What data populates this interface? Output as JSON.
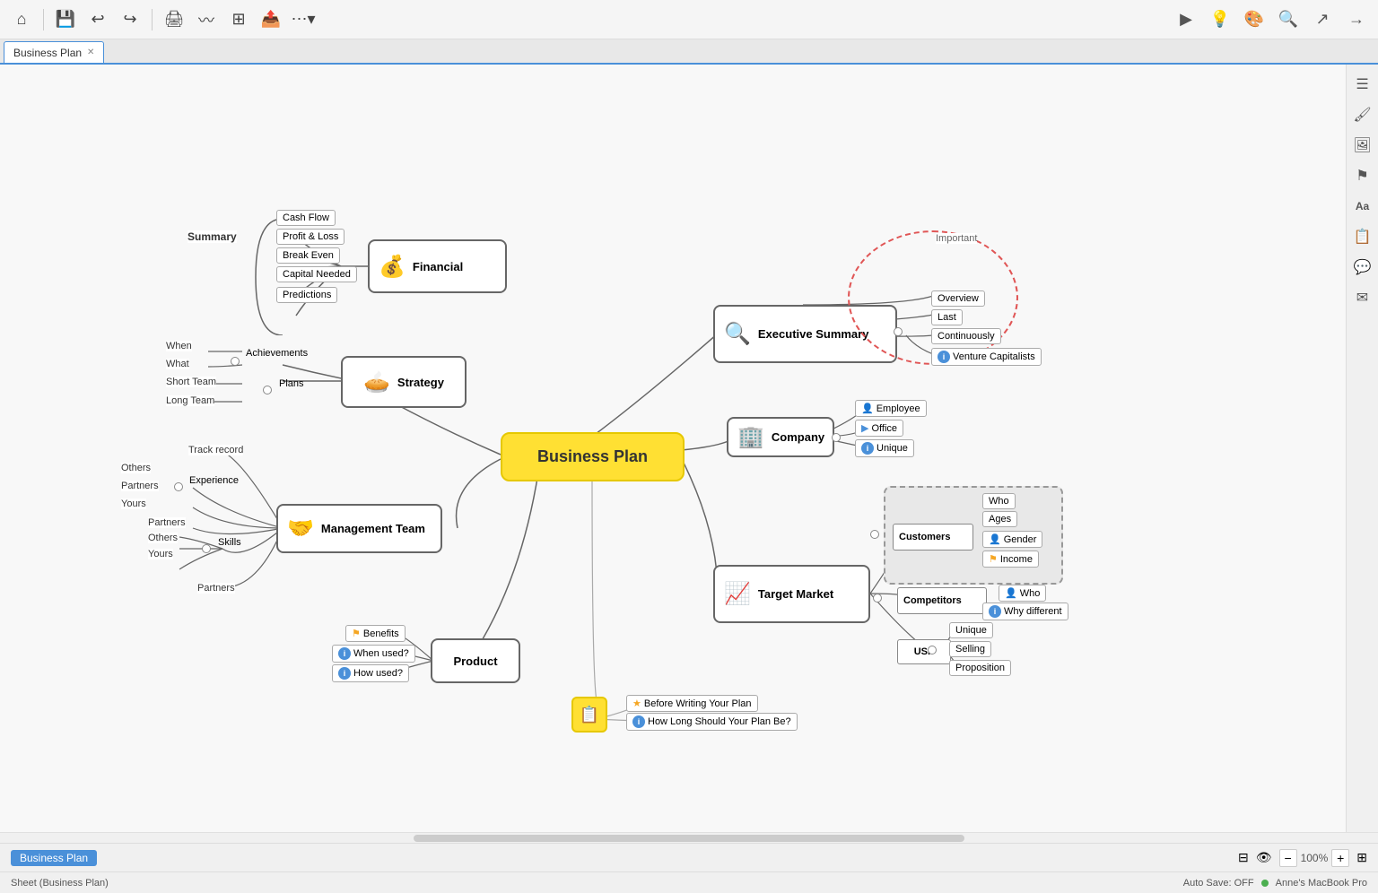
{
  "app": {
    "title": "Business Plan",
    "tab_label": "Business Plan",
    "sheet_label": "Sheet (Business Plan)"
  },
  "toolbar": {
    "home_icon": "⌂",
    "save_icon": "💾",
    "undo_icon": "↩",
    "redo_icon": "↪",
    "print_icon": "🖨",
    "more_icon": "⋯",
    "present_icon": "▶",
    "bulb_icon": "💡",
    "theme_icon": "▬",
    "search_icon": "🔍",
    "share_icon": "↗",
    "export_icon": "→"
  },
  "sidebar": {
    "list_icon": "☰",
    "brush_icon": "🖌",
    "image_icon": "🖼",
    "flag_icon": "⚑",
    "font_icon": "Aa",
    "note_icon": "📋",
    "chat_icon": "💬",
    "mail_icon": "✉"
  },
  "statusbar": {
    "sheet": "Sheet (Business Plan)",
    "autosave": "Auto Save: OFF",
    "user": "Anne's MacBook Pro",
    "zoom": "100%"
  },
  "nodes": {
    "central": "Business Plan",
    "financial": "Financial",
    "strategy": "Strategy",
    "executive_summary": "Executive Summary",
    "company": "Company",
    "management_team": "Management Team",
    "target_market": "Target Market",
    "product": "Product",
    "customers": "Customers",
    "competitors": "Competitors",
    "usp": "USP"
  },
  "financial_leaves": [
    "Cash Flow",
    "Profit & Loss",
    "Break Even",
    "Capital Needed",
    "Predictions"
  ],
  "financial_group": "Summary",
  "strategy_leaves": {
    "achievements_group": [
      "When",
      "What",
      "Short Team",
      "Long Team"
    ],
    "achievements_label": "Achievements",
    "plans_label": "Plans"
  },
  "executive_leaves": [
    "Overview",
    "Last",
    "Continuously",
    "Important",
    "Venture Capitalists"
  ],
  "company_leaves": [
    "Employee",
    "Office",
    "Unique"
  ],
  "management_leaves": {
    "track": "Track record",
    "experience_group": [
      "Others",
      "Partners",
      "Yours"
    ],
    "experience_label": "Experience",
    "skills_group": [
      "Partners",
      "Others",
      "Yours"
    ],
    "skills_label": "Skills",
    "partners": "Partners"
  },
  "target_leaves": {
    "customers_group": [
      "Who",
      "Ages",
      "Gender",
      "Income"
    ],
    "competitors_group": [
      "Who",
      "Why different"
    ],
    "usp_group": [
      "Unique",
      "Selling",
      "Proposition"
    ]
  },
  "product_leaves": [
    "Benefits",
    "When used?",
    "How used?"
  ],
  "bottom_notes": [
    "Before Writing Your Plan",
    "How Long Should Your Plan Be?"
  ]
}
